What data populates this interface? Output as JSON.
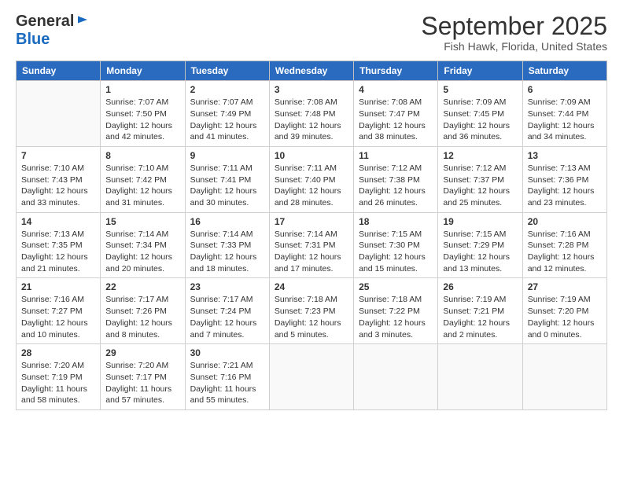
{
  "logo": {
    "general": "General",
    "blue": "Blue"
  },
  "header": {
    "month": "September 2025",
    "location": "Fish Hawk, Florida, United States"
  },
  "weekdays": [
    "Sunday",
    "Monday",
    "Tuesday",
    "Wednesday",
    "Thursday",
    "Friday",
    "Saturday"
  ],
  "weeks": [
    [
      {
        "day": "",
        "info": ""
      },
      {
        "day": "1",
        "info": "Sunrise: 7:07 AM\nSunset: 7:50 PM\nDaylight: 12 hours\nand 42 minutes."
      },
      {
        "day": "2",
        "info": "Sunrise: 7:07 AM\nSunset: 7:49 PM\nDaylight: 12 hours\nand 41 minutes."
      },
      {
        "day": "3",
        "info": "Sunrise: 7:08 AM\nSunset: 7:48 PM\nDaylight: 12 hours\nand 39 minutes."
      },
      {
        "day": "4",
        "info": "Sunrise: 7:08 AM\nSunset: 7:47 PM\nDaylight: 12 hours\nand 38 minutes."
      },
      {
        "day": "5",
        "info": "Sunrise: 7:09 AM\nSunset: 7:45 PM\nDaylight: 12 hours\nand 36 minutes."
      },
      {
        "day": "6",
        "info": "Sunrise: 7:09 AM\nSunset: 7:44 PM\nDaylight: 12 hours\nand 34 minutes."
      }
    ],
    [
      {
        "day": "7",
        "info": "Sunrise: 7:10 AM\nSunset: 7:43 PM\nDaylight: 12 hours\nand 33 minutes."
      },
      {
        "day": "8",
        "info": "Sunrise: 7:10 AM\nSunset: 7:42 PM\nDaylight: 12 hours\nand 31 minutes."
      },
      {
        "day": "9",
        "info": "Sunrise: 7:11 AM\nSunset: 7:41 PM\nDaylight: 12 hours\nand 30 minutes."
      },
      {
        "day": "10",
        "info": "Sunrise: 7:11 AM\nSunset: 7:40 PM\nDaylight: 12 hours\nand 28 minutes."
      },
      {
        "day": "11",
        "info": "Sunrise: 7:12 AM\nSunset: 7:38 PM\nDaylight: 12 hours\nand 26 minutes."
      },
      {
        "day": "12",
        "info": "Sunrise: 7:12 AM\nSunset: 7:37 PM\nDaylight: 12 hours\nand 25 minutes."
      },
      {
        "day": "13",
        "info": "Sunrise: 7:13 AM\nSunset: 7:36 PM\nDaylight: 12 hours\nand 23 minutes."
      }
    ],
    [
      {
        "day": "14",
        "info": "Sunrise: 7:13 AM\nSunset: 7:35 PM\nDaylight: 12 hours\nand 21 minutes."
      },
      {
        "day": "15",
        "info": "Sunrise: 7:14 AM\nSunset: 7:34 PM\nDaylight: 12 hours\nand 20 minutes."
      },
      {
        "day": "16",
        "info": "Sunrise: 7:14 AM\nSunset: 7:33 PM\nDaylight: 12 hours\nand 18 minutes."
      },
      {
        "day": "17",
        "info": "Sunrise: 7:14 AM\nSunset: 7:31 PM\nDaylight: 12 hours\nand 17 minutes."
      },
      {
        "day": "18",
        "info": "Sunrise: 7:15 AM\nSunset: 7:30 PM\nDaylight: 12 hours\nand 15 minutes."
      },
      {
        "day": "19",
        "info": "Sunrise: 7:15 AM\nSunset: 7:29 PM\nDaylight: 12 hours\nand 13 minutes."
      },
      {
        "day": "20",
        "info": "Sunrise: 7:16 AM\nSunset: 7:28 PM\nDaylight: 12 hours\nand 12 minutes."
      }
    ],
    [
      {
        "day": "21",
        "info": "Sunrise: 7:16 AM\nSunset: 7:27 PM\nDaylight: 12 hours\nand 10 minutes."
      },
      {
        "day": "22",
        "info": "Sunrise: 7:17 AM\nSunset: 7:26 PM\nDaylight: 12 hours\nand 8 minutes."
      },
      {
        "day": "23",
        "info": "Sunrise: 7:17 AM\nSunset: 7:24 PM\nDaylight: 12 hours\nand 7 minutes."
      },
      {
        "day": "24",
        "info": "Sunrise: 7:18 AM\nSunset: 7:23 PM\nDaylight: 12 hours\nand 5 minutes."
      },
      {
        "day": "25",
        "info": "Sunrise: 7:18 AM\nSunset: 7:22 PM\nDaylight: 12 hours\nand 3 minutes."
      },
      {
        "day": "26",
        "info": "Sunrise: 7:19 AM\nSunset: 7:21 PM\nDaylight: 12 hours\nand 2 minutes."
      },
      {
        "day": "27",
        "info": "Sunrise: 7:19 AM\nSunset: 7:20 PM\nDaylight: 12 hours\nand 0 minutes."
      }
    ],
    [
      {
        "day": "28",
        "info": "Sunrise: 7:20 AM\nSunset: 7:19 PM\nDaylight: 11 hours\nand 58 minutes."
      },
      {
        "day": "29",
        "info": "Sunrise: 7:20 AM\nSunset: 7:17 PM\nDaylight: 11 hours\nand 57 minutes."
      },
      {
        "day": "30",
        "info": "Sunrise: 7:21 AM\nSunset: 7:16 PM\nDaylight: 11 hours\nand 55 minutes."
      },
      {
        "day": "",
        "info": ""
      },
      {
        "day": "",
        "info": ""
      },
      {
        "day": "",
        "info": ""
      },
      {
        "day": "",
        "info": ""
      }
    ]
  ]
}
